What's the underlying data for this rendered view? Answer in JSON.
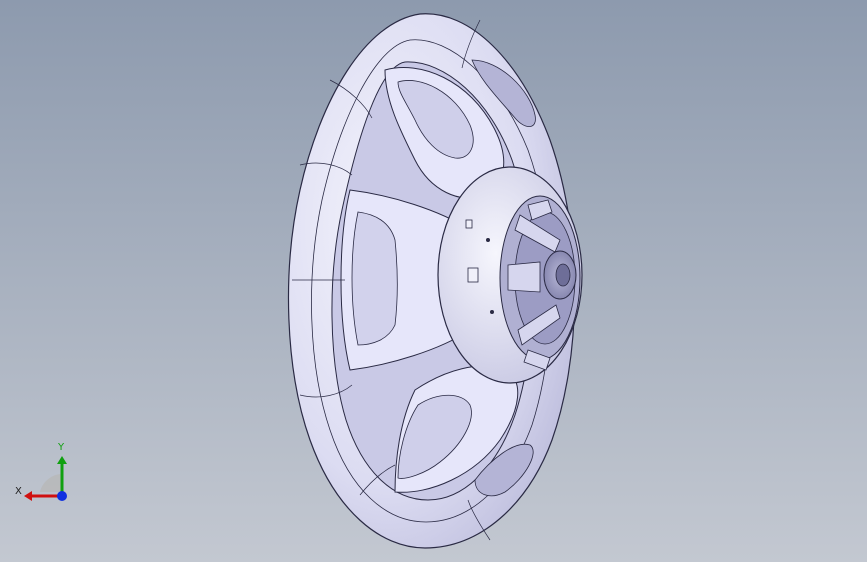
{
  "viewport": {
    "background_top": "#8d9aae",
    "background_bottom": "#c3c8d1"
  },
  "model": {
    "fill_color": "#e6e6fa",
    "shade_color": "#c9c9e6",
    "deep_color": "#a9a9cc",
    "edge_color": "#2a2a44"
  },
  "triad": {
    "x_label": "X",
    "y_label": "Y",
    "x_color": "#d01010",
    "y_color": "#10a010",
    "z_color": "#1030e0"
  }
}
